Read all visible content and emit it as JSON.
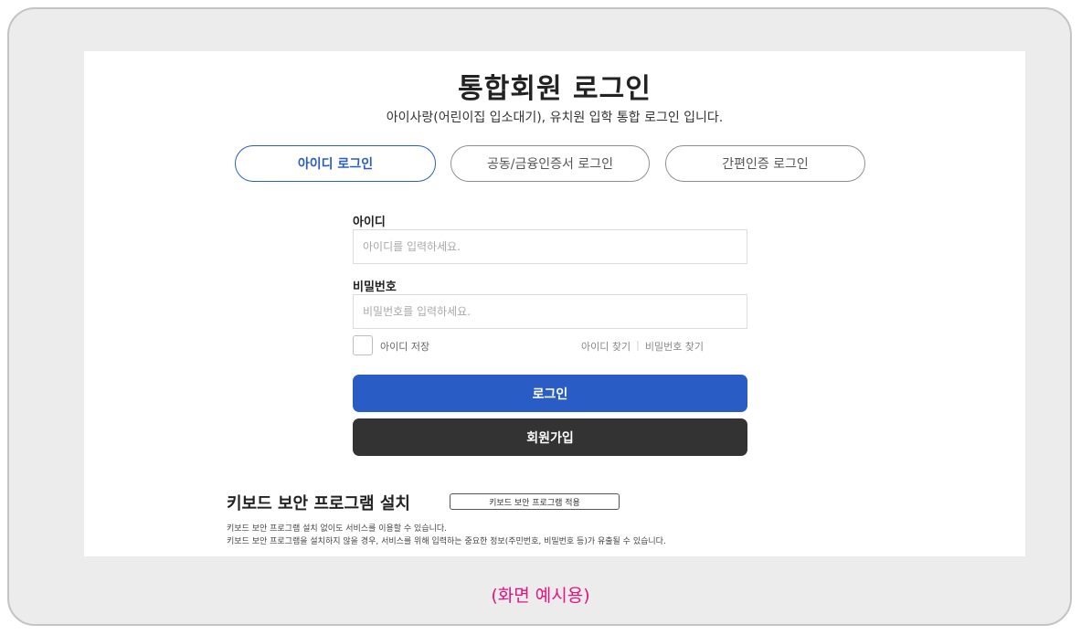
{
  "title": "통합회원 로그인",
  "subtitle": "아이사랑(어린이집 입소대기), 유치원 입학 통합 로그인 입니다.",
  "tabs": [
    {
      "label": "아이디 로그인",
      "active": true
    },
    {
      "label": "공동/금융인증서 로그인",
      "active": false
    },
    {
      "label": "간편인증 로그인",
      "active": false
    }
  ],
  "form": {
    "id_label": "아이디",
    "id_placeholder": "아이디를 입력하세요.",
    "id_value": "",
    "pw_label": "비밀번호",
    "pw_placeholder": "비밀번호를 입력하세요.",
    "pw_value": "",
    "save_id_label": "아이디 저장",
    "save_id_checked": false,
    "find_id_label": "아이디 찾기",
    "link_separator": "|",
    "find_pw_label": "비밀번호 찾기",
    "login_label": "로그인",
    "signup_label": "회원가입"
  },
  "keyboard_security": {
    "title": "키보드 보안 프로그램 설치",
    "apply_label": "키보드 보안 프로그램 적용",
    "note_1": "키보드 보안 프로그램 설치 없이도 서비스를 이용할 수 있습니다.",
    "note_2": "키보드 보안 프로그램을 설치하지 않을 경우, 서비스를 위해 입력하는 중요한 정보(주민번호, 비밀번호 등)가 유출될 수 있습니다."
  },
  "caption": "(화면 예시용)",
  "colors": {
    "accent": "#2a5cc6",
    "dark_button": "#333333",
    "caption": "#e0157f",
    "frame_background": "#ececed"
  }
}
